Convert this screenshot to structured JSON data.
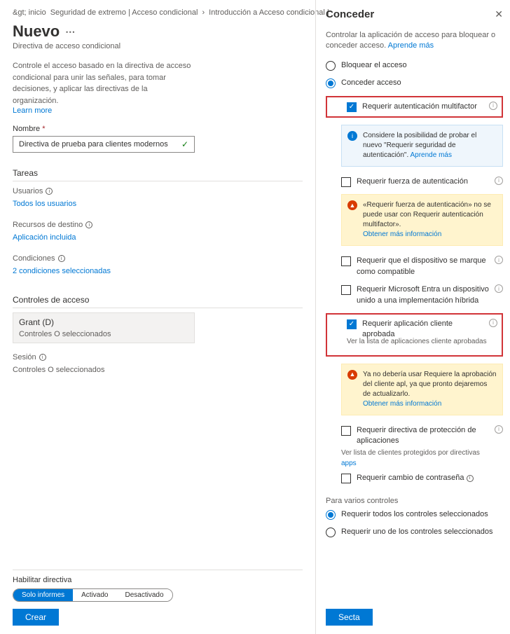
{
  "breadcrumb": {
    "home": "&gt; inicio",
    "sec": "Seguridad de extremo | Acceso condicional",
    "intro": "Introducción a Acceso condicional |"
  },
  "page": {
    "title": "Nuevo",
    "subtitle": "Directiva de acceso condicional",
    "desc": "Controle el acceso basado en la directiva de acceso condicional para unir las señales, para tomar decisiones, y aplicar las directivas de la organización.",
    "learn": "Learn more"
  },
  "name": {
    "label": "Nombre",
    "value": "Directiva de prueba para clientes modernos"
  },
  "tasks": {
    "head": "Tareas",
    "users_label": "Usuarios",
    "users_val": "Todos los usuarios",
    "target_label": "Recursos de destino",
    "target_val": "Aplicación incluida",
    "cond_label": "Condiciones",
    "cond_val": "2 condiciones seleccionadas"
  },
  "access": {
    "head": "Controles de acceso",
    "grant_title": "Grant (D)",
    "grant_sub": "Controles O seleccionados",
    "session_label": "Sesión",
    "session_val": "Controles O seleccionados"
  },
  "enable": {
    "label": "Habilitar directiva",
    "opt1": "Solo informes",
    "opt2": "Activado",
    "opt3": "Desactivado",
    "create": "Crear"
  },
  "panel": {
    "title": "Conceder",
    "desc": "Controlar la aplicación de acceso para bloquear o conceder acceso.",
    "learn": "Aprende más",
    "block": "Bloquear el acceso",
    "grant": "Conceder acceso",
    "mfa": "Requerir autenticación multifactor",
    "info_try": "Considere la posibilidad de probar el nuevo \"Requerir seguridad de autenticación\".",
    "info_learn": "Aprende más",
    "auth_strength": "Requerir fuerza de autenticación",
    "warn_strength": "«Requerir fuerza de autenticación» no se puede usar con Requerir autenticación multifactor».",
    "warn_learn": "Obtener más información",
    "compliant": "Requerir que el dispositivo se marque como compatible",
    "hybrid": "Requerir Microsoft Entra un dispositivo unido a una implementación híbrida",
    "approved": "Requerir aplicación cliente aprobada",
    "approved_link": "Ver la lista de aplicaciones cliente aprobadas",
    "warn_approved": "Ya no debería usar Requiere la aprobación del cliente apl, ya que pronto dejaremos de actualizarlo.",
    "protection": "Requerir directiva de protección de aplicaciones",
    "protection_link1": "Ver lista de clientes protegidos por directivas",
    "protection_link2": "apps",
    "password": "Requerir cambio de contraseña",
    "multi_head": "Para varios controles",
    "multi_all": "Requerir todos los controles seleccionados",
    "multi_one": "Requerir uno de los controles seleccionados",
    "select": "Secta"
  }
}
